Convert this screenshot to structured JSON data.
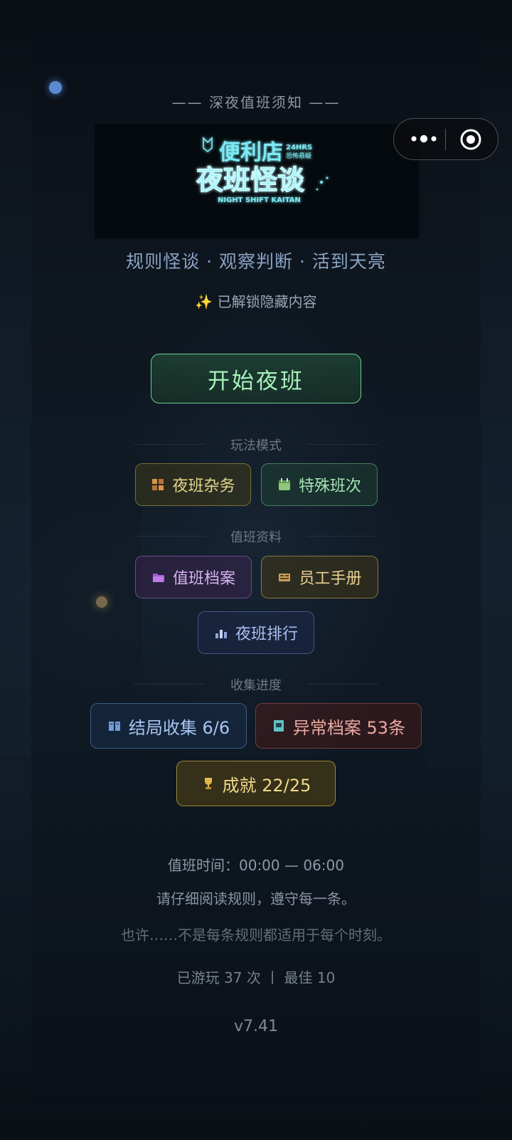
{
  "header": {
    "top_title": "—— 深夜值班须知 ——",
    "logo": {
      "line1": "便利店",
      "tag1": "24HRS",
      "tag2": "恐怖悬疑",
      "line2": "夜班怪谈",
      "english": "NIGHT SHIFT KAITAN"
    },
    "capsule": {
      "more_icon": "more-dots-icon",
      "close_icon": "target-circle-icon"
    }
  },
  "tagline": "规则怪谈 · 观察判断 · 活到天亮",
  "unlock_notice": {
    "icon": "sparkles-icon",
    "text": "已解锁隐藏内容"
  },
  "start_button": "开始夜班",
  "sections": {
    "modes": {
      "label": "玩法模式",
      "buttons": [
        {
          "label": "夜班杂务",
          "icon": "tasks-icon"
        },
        {
          "label": "特殊班次",
          "icon": "calendar-icon"
        }
      ]
    },
    "records": {
      "label": "值班资料",
      "buttons": [
        {
          "label": "值班档案",
          "icon": "folder-icon"
        },
        {
          "label": "员工手册",
          "icon": "handbook-icon"
        },
        {
          "label": "夜班排行",
          "icon": "ranking-icon"
        }
      ]
    },
    "progress": {
      "label": "收集进度",
      "buttons": [
        {
          "label": "结局收集 6/6",
          "icon": "book-icon"
        },
        {
          "label": "异常档案 53条",
          "icon": "file-icon"
        },
        {
          "label": "成就 22/25",
          "icon": "trophy-icon"
        }
      ]
    }
  },
  "footer": {
    "shift_time": "值班时间：00:00 — 06:00",
    "read_rules": "请仔细阅读规则，遵守每一条。",
    "hint": "也许……不是每条规则都适用于每个时刻。",
    "stats": "已游玩 37 次 丨 最佳 10",
    "version": "v7.41"
  },
  "colors": {
    "start_accent": "#6bd18d",
    "tagline": "#8aa3c4",
    "neon_sign": "#64e6f0"
  }
}
